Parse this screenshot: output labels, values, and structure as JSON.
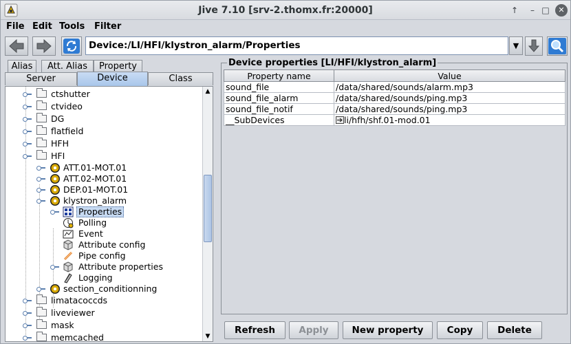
{
  "window": {
    "title": "Jive 7.10 [srv-2.thomx.fr:20000]",
    "controls": {
      "keep_above": "↑",
      "minimize": "–",
      "maximize": "□",
      "close": "✕"
    }
  },
  "menu": {
    "items": [
      "File",
      "Edit",
      "Tools",
      "Filter"
    ]
  },
  "toolbar": {
    "path": "Device:/LI/HFI/klystron_alarm/Properties",
    "icons": [
      "back-arrow-icon",
      "forward-arrow-icon",
      "refresh-icon",
      "download-arrow-icon",
      "search-icon"
    ],
    "dropdown_glyph": "▼"
  },
  "tabs": {
    "row1": [
      "Alias",
      "Att. Alias",
      "Property"
    ],
    "row2": [
      "Server",
      "Device",
      "Class"
    ],
    "active": "Device"
  },
  "tree": {
    "items": [
      {
        "label": "ctshutter",
        "type": "folder"
      },
      {
        "label": "ctvideo",
        "type": "folder"
      },
      {
        "label": "DG",
        "type": "folder"
      },
      {
        "label": "flatfield",
        "type": "folder"
      },
      {
        "label": "HFH",
        "type": "folder"
      },
      {
        "label": "HFI",
        "type": "folder"
      },
      {
        "label": "ATT.01-MOT.01",
        "type": "device"
      },
      {
        "label": "ATT.02-MOT.01",
        "type": "device"
      },
      {
        "label": "DEP.01-MOT.01",
        "type": "device"
      },
      {
        "label": "klystron_alarm",
        "type": "device"
      },
      {
        "label": "Properties",
        "type": "properties",
        "selected": true
      },
      {
        "label": "Polling",
        "type": "polling"
      },
      {
        "label": "Event",
        "type": "event"
      },
      {
        "label": "Attribute config",
        "type": "attr-config"
      },
      {
        "label": "Pipe config",
        "type": "pipe"
      },
      {
        "label": "Attribute properties",
        "type": "attr-props"
      },
      {
        "label": "Logging",
        "type": "logging"
      },
      {
        "label": "section_conditionning",
        "type": "device"
      },
      {
        "label": "limatacoccds",
        "type": "folder"
      },
      {
        "label": "liveviewer",
        "type": "folder"
      },
      {
        "label": "mask",
        "type": "folder"
      },
      {
        "label": "memcached",
        "type": "folder"
      }
    ]
  },
  "properties": {
    "title": "Device properties [LI/HFI/klystron_alarm]",
    "columns": [
      "Property name",
      "Value"
    ],
    "rows": [
      {
        "name": "sound_file",
        "value": "/data/shared/sounds/alarm.mp3"
      },
      {
        "name": "sound_file_alarm",
        "value": "/data/shared/sounds/ping.mp3"
      },
      {
        "name": "sound_file_notif",
        "value": "/data/shared/sounds/ping.mp3"
      },
      {
        "name": "__SubDevices",
        "value": "li/hfh/shf.01-mod.01"
      }
    ]
  },
  "buttons": {
    "refresh": "Refresh",
    "apply": "Apply",
    "new_property": "New property",
    "copy": "Copy",
    "delete": "Delete"
  }
}
